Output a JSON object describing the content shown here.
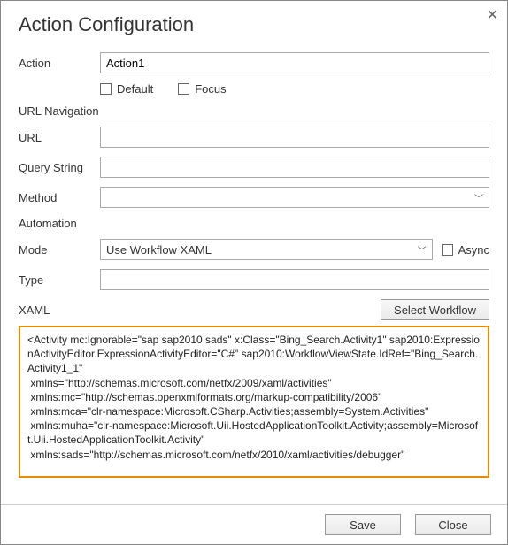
{
  "dialog": {
    "title": "Action Configuration"
  },
  "action": {
    "label": "Action",
    "value": "Action1",
    "default_label": "Default",
    "focus_label": "Focus"
  },
  "nav_section": "URL Navigation",
  "url": {
    "label": "URL",
    "value": ""
  },
  "query": {
    "label": "Query String",
    "value": ""
  },
  "method": {
    "label": "Method",
    "selected": ""
  },
  "automation_section": "Automation",
  "mode": {
    "label": "Mode",
    "selected": "Use Workflow XAML",
    "async_label": "Async"
  },
  "type": {
    "label": "Type",
    "value": ""
  },
  "xaml": {
    "label": "XAML",
    "select_button": "Select Workflow",
    "content": "<Activity mc:Ignorable=\"sap sap2010 sads\" x:Class=\"Bing_Search.Activity1\" sap2010:ExpressionActivityEditor.ExpressionActivityEditor=\"C#\" sap2010:WorkflowViewState.IdRef=\"Bing_Search.Activity1_1\"\n xmlns=\"http://schemas.microsoft.com/netfx/2009/xaml/activities\"\n xmlns:mc=\"http://schemas.openxmlformats.org/markup-compatibility/2006\"\n xmlns:mca=\"clr-namespace:Microsoft.CSharp.Activities;assembly=System.Activities\"\n xmlns:muha=\"clr-namespace:Microsoft.Uii.HostedApplicationToolkit.Activity;assembly=Microsoft.Uii.HostedApplicationToolkit.Activity\"\n xmlns:sads=\"http://schemas.microsoft.com/netfx/2010/xaml/activities/debugger\""
  },
  "footer": {
    "save": "Save",
    "close": "Close"
  }
}
